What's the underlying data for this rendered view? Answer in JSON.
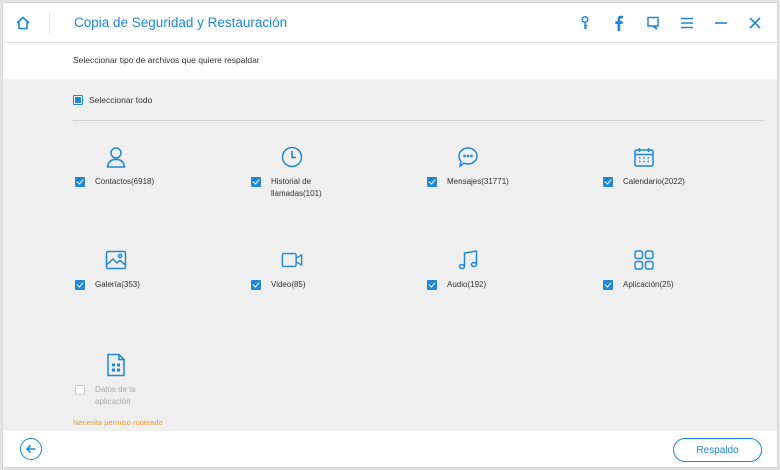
{
  "window": {
    "title": "Copia de Seguridad y Restauración",
    "title_icons": [
      "key-icon",
      "facebook-icon",
      "feedback-icon",
      "menu-icon",
      "minimize-icon",
      "close-icon"
    ]
  },
  "subheader": {
    "text": "Seleccionar tipo de archivos que quiere respaldar"
  },
  "select_all": {
    "label": "Seleccionar todo",
    "state": "partial"
  },
  "items": [
    {
      "label": "Contactos(6918)",
      "icon": "contacts-icon",
      "checked": true
    },
    {
      "label": "Historial de llamadas(101)",
      "icon": "clock-icon",
      "checked": true
    },
    {
      "label": "Mensajes(31771)",
      "icon": "message-icon",
      "checked": true
    },
    {
      "label": "Calendario(2022)",
      "icon": "calendar-icon",
      "checked": true
    },
    {
      "label": "Galería(353)",
      "icon": "gallery-icon",
      "checked": true
    },
    {
      "label": "Video(85)",
      "icon": "video-icon",
      "checked": true
    },
    {
      "label": "Audio(192)",
      "icon": "music-icon",
      "checked": true
    },
    {
      "label": "Aplicación(25)",
      "icon": "apps-icon",
      "checked": true
    },
    {
      "label": "Datos de la aplicación",
      "icon": "app-data-icon",
      "checked": false,
      "disabled": true
    }
  ],
  "root_warning": "Necesita permiso rooteado",
  "footer": {
    "backup_label": "Respaldo"
  },
  "colors": {
    "accent": "#1f87d6",
    "warning": "#f29a1e",
    "disabled": "#a8a8a8"
  }
}
